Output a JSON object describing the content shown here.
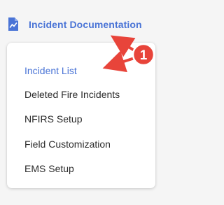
{
  "header": {
    "title": "Incident Documentation",
    "icon": "document-chart-icon",
    "accent_color": "#4a74d6"
  },
  "menu": {
    "items": [
      {
        "label": "Incident List",
        "active": true
      },
      {
        "label": "Deleted Fire Incidents",
        "active": false
      },
      {
        "label": "NFIRS Setup",
        "active": false
      },
      {
        "label": "Field Customization",
        "active": false
      },
      {
        "label": "EMS Setup",
        "active": false
      }
    ]
  },
  "annotation": {
    "badge_number": "1",
    "badge_color": "#e8443a"
  }
}
